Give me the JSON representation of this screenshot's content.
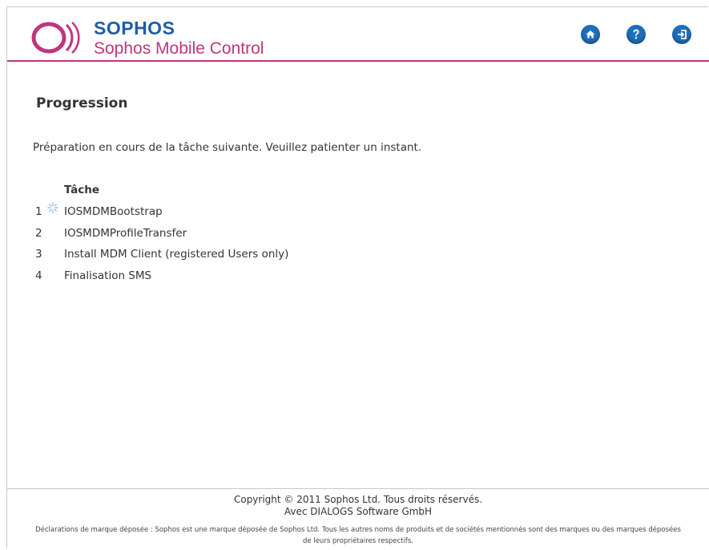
{
  "header": {
    "brand": "SOPHOS",
    "product": "Sophos Mobile Control",
    "icons": [
      "home-icon",
      "help-icon",
      "logout-icon"
    ]
  },
  "colors": {
    "brand_blue": "#1d5ea8",
    "accent_magenta": "#c0357b",
    "icon_blue": "#1e6fbb"
  },
  "main": {
    "title": "Progression",
    "intro": "Préparation en cours de la tâche suivante. Veuillez patienter un instant.",
    "task_header": "Tâche",
    "tasks": [
      {
        "num": "1",
        "name": "IOSMDMBootstrap",
        "in_progress": true
      },
      {
        "num": "2",
        "name": "IOSMDMProfileTransfer"
      },
      {
        "num": "3",
        "name": "Install MDM Client (registered Users only)"
      },
      {
        "num": "4",
        "name": "Finalisation SMS"
      }
    ]
  },
  "footer": {
    "copyright": "Copyright © 2011 Sophos Ltd. Tous droits réservés.",
    "partner": "Avec DIALOGS Software GmbH",
    "trademark_line1": "Déclarations de marque déposée : Sophos est une marque déposée de Sophos Ltd. Tous les autres noms de produits et de sociétés mentionnés sont des marques ou des marques déposées",
    "trademark_line2": "de leurs propriétaires respectifs."
  }
}
